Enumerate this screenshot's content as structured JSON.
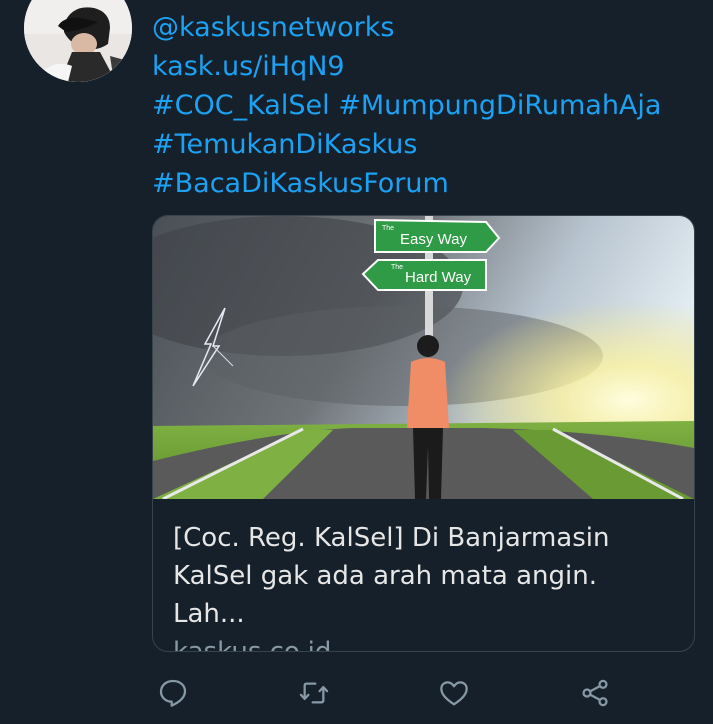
{
  "tweet": {
    "lines": [
      "@kaskusnetworks",
      "kask.us/iHqN9",
      "#COC_KalSel #MumpungDiRumahAja",
      "#TemukanDiKaskus",
      "#BacaDiKaskusForum"
    ]
  },
  "card": {
    "image": {
      "sign_top_small": "The",
      "sign_top": "Easy Way",
      "sign_bottom_small": "The",
      "sign_bottom": "Hard Way"
    },
    "title": "[Coc. Reg. KalSel] Di Banjarmasin KalSel gak ada arah mata angin. Lah...",
    "domain": "kaskus.co.id"
  },
  "actions": {
    "icons": [
      "reply-icon",
      "retweet-icon",
      "like-icon",
      "share-icon"
    ],
    "color": "#8899a6"
  },
  "colors": {
    "background": "#15202b",
    "link": "#1da1f2",
    "border": "#38444d"
  }
}
